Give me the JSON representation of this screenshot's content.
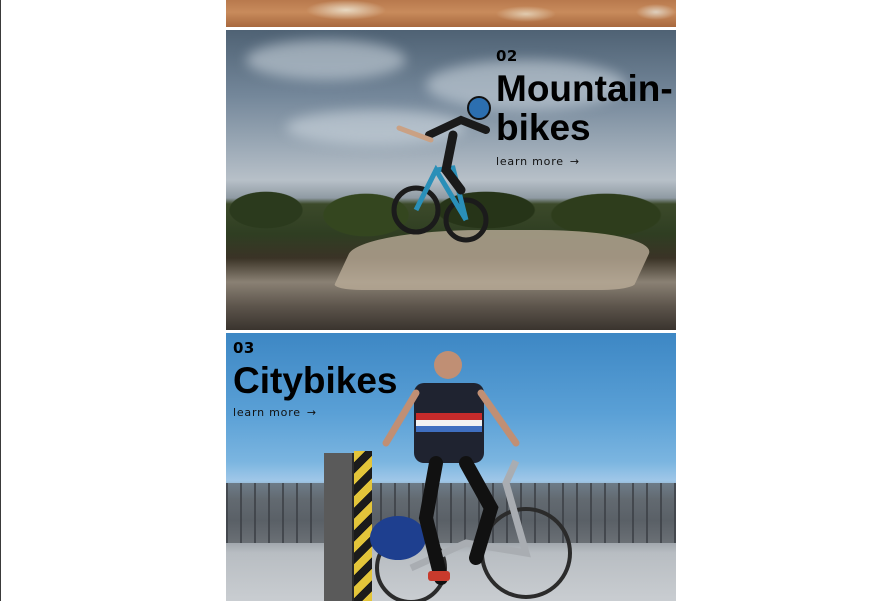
{
  "tiles": [
    {
      "id": "top-cropped",
      "image": "desert-ground-photo"
    },
    {
      "id": "mountainbikes",
      "number": "02",
      "title_line1": "Mountain-",
      "title_line2": "bikes",
      "link_label": "learn more",
      "link_arrow": "→",
      "image": "mountain-biker-jump-photo"
    },
    {
      "id": "citybikes",
      "number": "03",
      "title": "Citybikes",
      "link_label": "learn more",
      "link_arrow": "→",
      "image": "city-bike-rider-photo"
    }
  ],
  "colors": {
    "text": "#000000",
    "background": "#ffffff"
  }
}
